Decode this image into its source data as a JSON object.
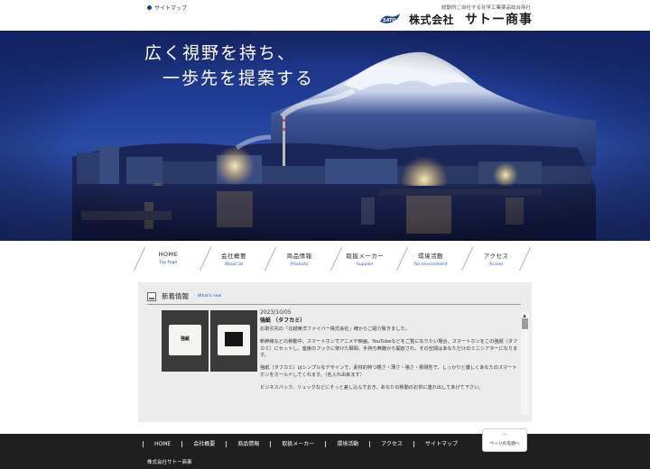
{
  "header": {
    "sitemap_label": "サイトマップ",
    "tagline": "総動的ご自社する化学工業薬品総合商社",
    "company_kind": "株式会社",
    "company_name": "サトー商事"
  },
  "hero": {
    "catch_line1": "広く視野を持ち、",
    "catch_line2": "一歩先を提案する"
  },
  "nav": {
    "items": [
      {
        "jp": "HOME",
        "en": "Top Page"
      },
      {
        "jp": "会社概要",
        "en": "About Us"
      },
      {
        "jp": "商品情報",
        "en": "Products"
      },
      {
        "jp": "取扱メーカー",
        "en": "Supplier"
      },
      {
        "jp": "環境活動",
        "en": "For environment"
      },
      {
        "jp": "アクセス",
        "en": "Access"
      }
    ]
  },
  "news": {
    "title": "新着情報",
    "title_en": "What's new",
    "photo1_label": "強紙",
    "date": "2023/10/05",
    "item_title": "強紙 （タフカミ）",
    "paragraphs": [
      "お取引先の「北越東洋ファイバー株式会社」様からご紹介致きました。",
      "新幹線などの移動中、スマートホンでアニメや映画、YouTubeなどをご覧になりたい場合、スマートホンをこの強紙（タフカミ）にセットし、座席のフックに架けた瞬間、手持ち無聴から開放され、その空間はあなただけのミニシアターになります。",
      "強紙（タフカミ）はシンプルなデザインで、素材的特つ軽さ・薄さ・強さ・柔剛性で、しっかりと優しくあなたのスマートホンをホールドしてくれます。（名入れ出来ます）",
      "ビジネスバック、リュックなどにそっと差し込んでおき、あなたの移動のお供に連れ出してあげて下さい。"
    ]
  },
  "footer": {
    "links": [
      "HOME",
      "会社概要",
      "商品情報",
      "取扱メーカー",
      "環境活動",
      "アクセス",
      "サイトマップ"
    ],
    "copyright": "株式会社サトー商事",
    "pagetop_label": "ページの先頭へ"
  },
  "colors": {
    "brand_blue": "#1d3f8f",
    "link_blue": "#1f5fb8",
    "footer_bg": "#1f1f1f",
    "news_bg": "#ececec"
  }
}
